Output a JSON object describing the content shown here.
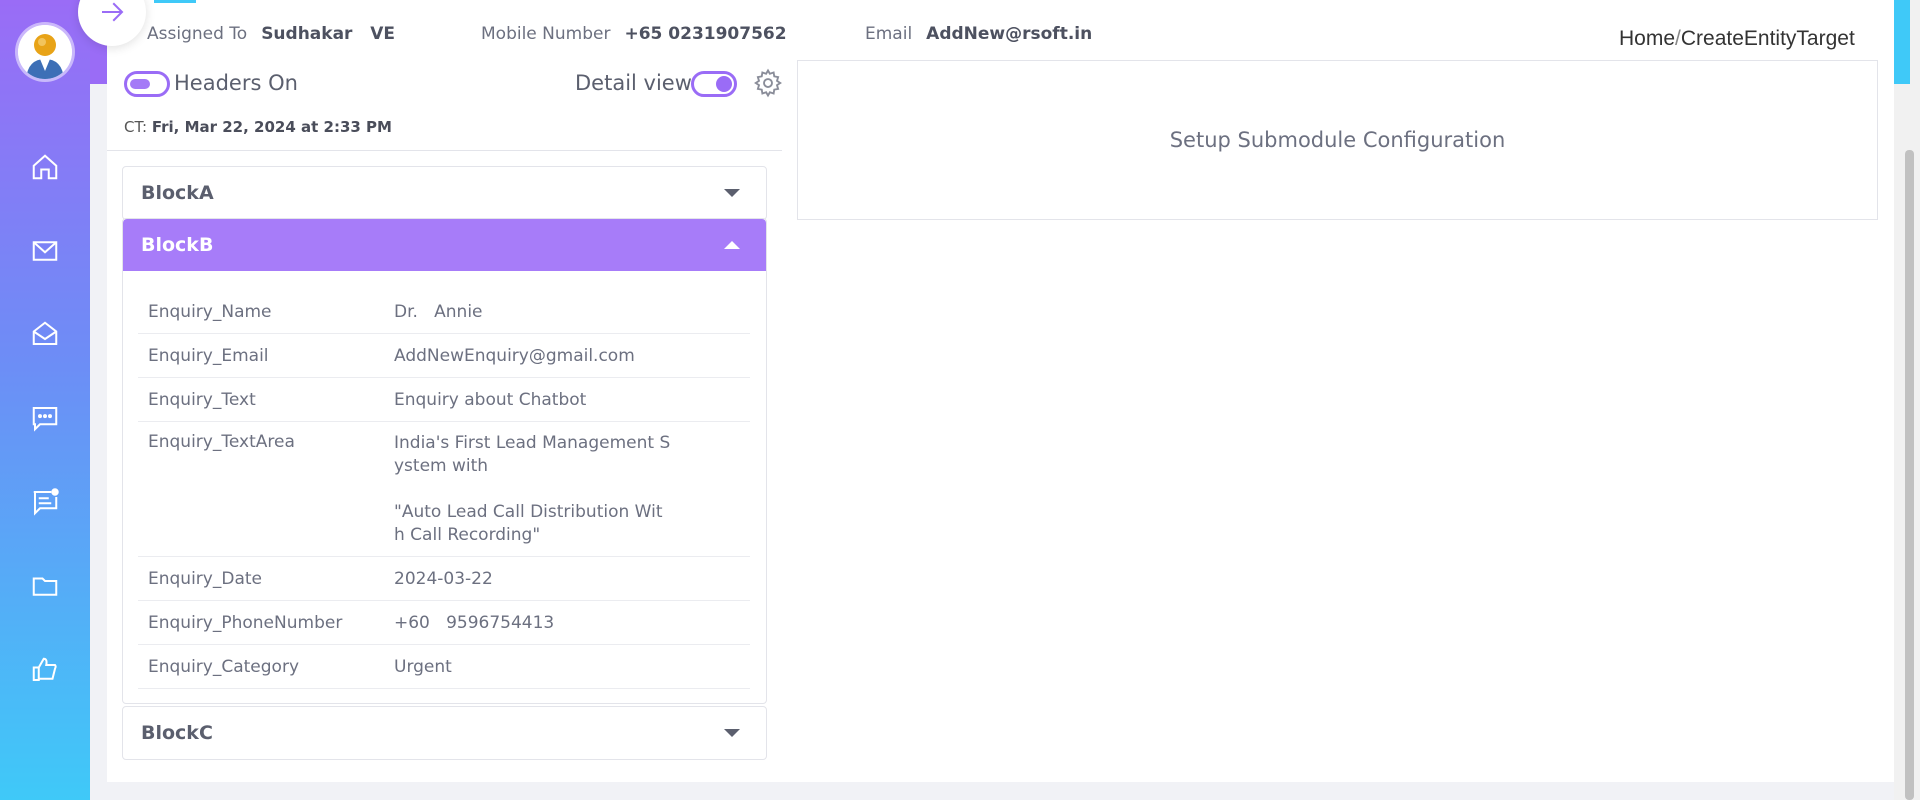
{
  "header": {
    "assigned_label": "Assigned To",
    "assigned_value": "Sudhakar   VE",
    "mobile_label": "Mobile Number",
    "mobile_value": "+65 0231907562",
    "email_label": "Email",
    "email_value": "AddNew@rsoft.in"
  },
  "breadcrumb": {
    "home": "Home",
    "sep": "/",
    "page": "CreateEntityTarget"
  },
  "toggles": {
    "headers_label": "Headers On",
    "detail_label": "Detail view"
  },
  "ct": {
    "prefix": "CT:",
    "value": "Fri, Mar 22, 2024 at 2:33 PM"
  },
  "blocks": {
    "a": "BlockA",
    "b": "BlockB",
    "c": "BlockC"
  },
  "fields": [
    {
      "key": "Enquiry_Name",
      "value": "Dr.   Annie"
    },
    {
      "key": "Enquiry_Email",
      "value": "AddNewEnquiry@gmail.com"
    },
    {
      "key": "Enquiry_Text",
      "value": "Enquiry about Chatbot"
    },
    {
      "key": "Enquiry_TextArea",
      "lines": [
        "India's First Lead Management S",
        "ystem with",
        "",
        "\"Auto Lead Call Distribution Wit",
        "h Call Recording\""
      ]
    },
    {
      "key": "Enquiry_Date",
      "value": "2024-03-22"
    },
    {
      "key": "Enquiry_PhoneNumber",
      "value": "+60   9596754413"
    },
    {
      "key": "Enquiry_Category",
      "value": "Urgent"
    }
  ],
  "setup_text": "Setup Submodule Configuration",
  "sidebar_icons": [
    "home-icon",
    "mail-icon",
    "mail-open-icon",
    "chat-icon",
    "feedback-icon",
    "folder-icon",
    "thumbs-up-icon"
  ],
  "colors": {
    "accent": "#9a6cf6",
    "gradient_bottom": "#3fc9f8",
    "active_block": "#a77cf9"
  }
}
